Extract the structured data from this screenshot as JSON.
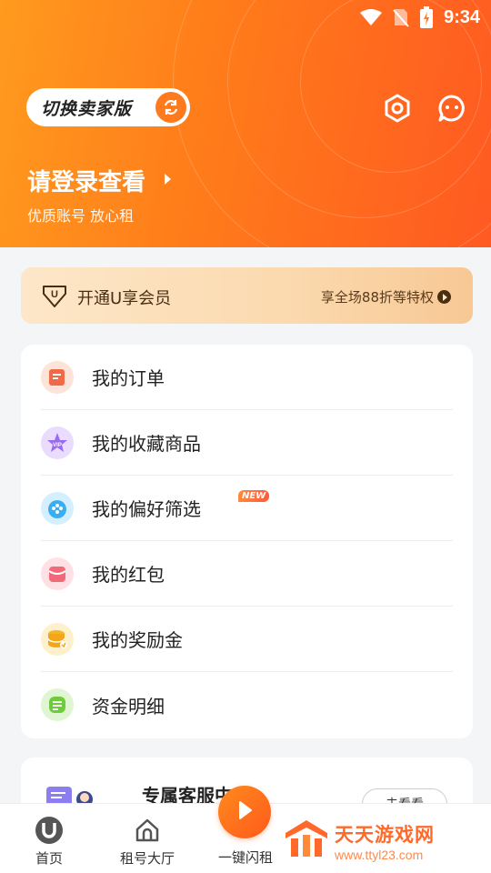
{
  "status_bar": {
    "time": "9:34"
  },
  "header": {
    "switch_label": "切换卖家版",
    "login_title": "请登录查看",
    "login_subtitle": "优质账号 放心租",
    "settings_icon": "settings-hex-icon",
    "message_icon": "message-bubble-icon"
  },
  "vip": {
    "label": "开通U享会员",
    "promo": "享全场88折等特权",
    "icon": "u-shield-icon",
    "colors": {
      "bg_start": "#fde7c9",
      "bg_end": "#f7c894",
      "text": "#4a2e12"
    }
  },
  "menu": {
    "items": [
      {
        "label": "我的订单",
        "icon": "order-icon",
        "color": "#f06a4a"
      },
      {
        "label": "我的收藏商品",
        "icon": "vip-star-icon",
        "color": "#9b6af0"
      },
      {
        "label": "我的偏好筛选",
        "icon": "preference-icon",
        "color": "#3aaef0",
        "badge": "NEW"
      },
      {
        "label": "我的红包",
        "icon": "red-packet-icon",
        "color": "#f06a7a"
      },
      {
        "label": "我的奖励金",
        "icon": "coin-stack-icon",
        "color": "#f5b52a"
      },
      {
        "label": "资金明细",
        "icon": "funds-list-icon",
        "color": "#6ccc3a"
      }
    ]
  },
  "service": {
    "title": "专属客服中",
    "button": "去看看"
  },
  "bottom_nav": {
    "items": [
      {
        "label": "首页",
        "icon": "home-u-icon"
      },
      {
        "label": "租号大厅",
        "icon": "hall-house-icon"
      },
      {
        "label": "一键闪租",
        "icon": "flash-rent-icon"
      }
    ]
  },
  "watermark": {
    "name": "天天游戏网",
    "url": "www.ttyl23.com"
  },
  "colors": {
    "brand_orange": "#ff7a1a",
    "page_bg": "#f4f5f7"
  }
}
